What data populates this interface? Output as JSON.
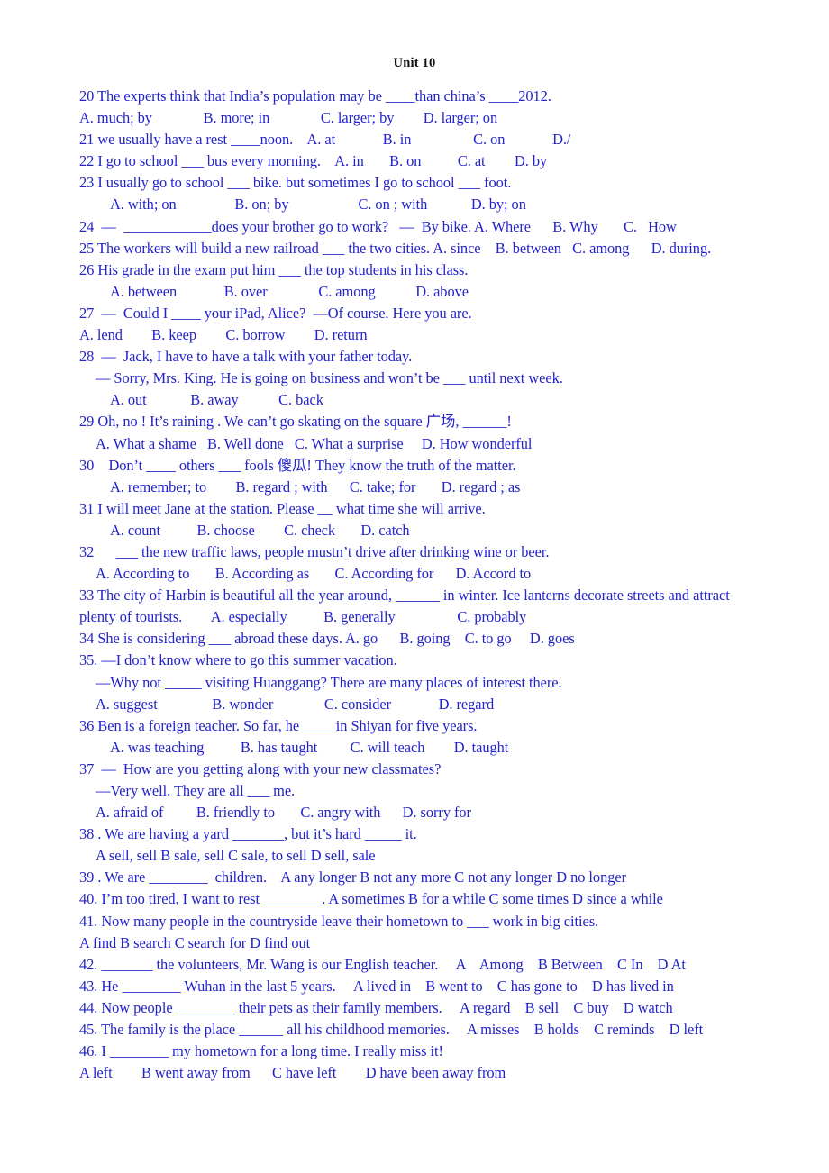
{
  "document": {
    "title": "Unit 10",
    "text_color": "#2222cc",
    "title_color": "#111111",
    "background_color": "#ffffff"
  },
  "lines": [
    {
      "id": "q20-stem",
      "indent": 0,
      "text": "20 The experts think that India’s population may be ____than china’s ____2012."
    },
    {
      "id": "q20-options",
      "indent": 0,
      "text": "A. much; by              B. more; in              C. larger; by        D. larger; on"
    },
    {
      "id": "q21",
      "indent": 0,
      "text": "21 we usually have a rest ____noon.    A. at             B. in                 C. on             D./"
    },
    {
      "id": "q22",
      "indent": 0,
      "text": "22 I go to school ___ bus every morning.    A. in       B. on          C. at        D. by"
    },
    {
      "id": "q23-stem",
      "indent": 0,
      "text": "23 I usually go to school ___ bike. but sometimes I go to school ___ foot."
    },
    {
      "id": "q23-options",
      "indent": 2,
      "text": "A. with; on                B. on; by                   C. on ; with            D. by; on"
    },
    {
      "id": "q24",
      "indent": 0,
      "text": "24  —  ____________does your brother go to work?   —  By bike. A. Where      B. Why       C.   How"
    },
    {
      "id": "q25",
      "indent": 0,
      "text": "25 The workers will build a new railroad ___ the two cities. A. since    B. between   C. among      D. during."
    },
    {
      "id": "q26-stem",
      "indent": 0,
      "text": "26 His grade in the exam put him ___ the top students in his class."
    },
    {
      "id": "q26-options",
      "indent": 2,
      "text": "A. between             B. over              C. among           D. above"
    },
    {
      "id": "q27-stem",
      "indent": 0,
      "text": "27  —  Could I ____ your iPad, Alice?  —Of course. Here you are."
    },
    {
      "id": "q27-options",
      "indent": 0,
      "text": "A. lend        B. keep        C. borrow        D. return"
    },
    {
      "id": "q28-stem",
      "indent": 0,
      "text": "28  —  Jack, I have to have a talk with your father today."
    },
    {
      "id": "q28-reply",
      "indent": 1,
      "text": "— Sorry, Mrs. King. He is going on business and won’t be ___ until next week."
    },
    {
      "id": "q28-options",
      "indent": 2,
      "text": "A. out            B. away           C. back"
    },
    {
      "id": "q29-stem",
      "indent": 0,
      "text": "29 Oh, no ! It’s raining . We can’t go skating on the square 广场, ______!"
    },
    {
      "id": "q29-options",
      "indent": 1,
      "text": "A. What a shame   B. Well done   C. What a surprise     D. How wonderful"
    },
    {
      "id": "q30-stem",
      "indent": 0,
      "text": "30    Don’t ____ others ___ fools 傻瓜! They know the truth of the matter."
    },
    {
      "id": "q30-options",
      "indent": 2,
      "text": "A. remember; to        B. regard ; with      C. take; for       D. regard ; as"
    },
    {
      "id": "q31-stem",
      "indent": 0,
      "text": "31 I will meet Jane at the station. Please __ what time she will arrive."
    },
    {
      "id": "q31-options",
      "indent": 2,
      "text": "A. count          B. choose        C. check       D. catch"
    },
    {
      "id": "q32-stem",
      "indent": 0,
      "text": "32      ___ the new traffic laws, people mustn’t drive after drinking wine or beer."
    },
    {
      "id": "q32-options",
      "indent": 1,
      "text": "A. According to       B. According as       C. According for      D. Accord to"
    },
    {
      "id": "q33-stem",
      "indent": 0,
      "text": "33 The city of Harbin is beautiful all the year around, ______ in winter. Ice lanterns decorate streets and attract"
    },
    {
      "id": "q33-cont",
      "indent": 0,
      "text": "plenty of tourists.        A. especially          B. generally                 C. probably"
    },
    {
      "id": "q34",
      "indent": 0,
      "text": "34 She is considering ___ abroad these days. A. go      B. going    C. to go     D. goes"
    },
    {
      "id": "q35-stem",
      "indent": 0,
      "text": "35. —I don’t know where to go this summer vacation."
    },
    {
      "id": "q35-reply",
      "indent": 1,
      "text": "—Why not _____ visiting Huanggang? There are many places of interest there."
    },
    {
      "id": "q35-options",
      "indent": 1,
      "text": "A. suggest               B. wonder              C. consider             D. regard"
    },
    {
      "id": "q36-stem",
      "indent": 0,
      "text": "36 Ben is a foreign teacher. So far, he ____ in Shiyan for five years."
    },
    {
      "id": "q36-options",
      "indent": 2,
      "text": "A. was teaching          B. has taught         C. will teach        D. taught"
    },
    {
      "id": "q37-stem",
      "indent": 0,
      "text": "37  —  How are you getting along with your new classmates?"
    },
    {
      "id": "q37-reply",
      "indent": 1,
      "text": "—Very well. They are all ___ me."
    },
    {
      "id": "q37-options",
      "indent": 1,
      "text": "A. afraid of         B. friendly to       C. angry with      D. sorry for"
    },
    {
      "id": "q38-stem",
      "indent": 0,
      "text": "38 . We are having a yard _______, but it’s hard _____ it."
    },
    {
      "id": "q38-options",
      "indent": 1,
      "text": "A sell, sell B sale, sell C sale, to sell D sell, sale"
    },
    {
      "id": "q39",
      "indent": 0,
      "text": "39 . We are ________  children.    A any longer B not any more C not any longer D no longer"
    },
    {
      "id": "q40",
      "indent": 0,
      "text": "40. I’m too tired, I want to rest ________. A sometimes B for a while C some times D since a while"
    },
    {
      "id": "q41-stem",
      "indent": 0,
      "text": "41. Now many people in the countryside leave their hometown to ___ work in big cities."
    },
    {
      "id": "q41-options",
      "indent": 0,
      "text": "A find B search C search for D find out"
    },
    {
      "id": "q42",
      "indent": 0,
      "text": "42. _______ the volunteers, Mr. Wang is our English teacher.     A    Among    B Between    C In    D At"
    },
    {
      "id": "q43",
      "indent": 0,
      "text": "43. He ________ Wuhan in the last 5 years.     A lived in    B went to    C has gone to    D has lived in"
    },
    {
      "id": "q44",
      "indent": 0,
      "text": "44. Now people ________ their pets as their family members.     A regard    B sell    C buy    D watch"
    },
    {
      "id": "q45",
      "indent": 0,
      "text": "45. The family is the place ______ all his childhood memories.     A misses    B holds    C reminds    D left"
    },
    {
      "id": "q46-stem",
      "indent": 0,
      "text": "46. I ________ my hometown for a long time. I really miss it!"
    },
    {
      "id": "q46-options",
      "indent": 0,
      "text": "A left        B went away from      C have left        D have been away from"
    }
  ]
}
